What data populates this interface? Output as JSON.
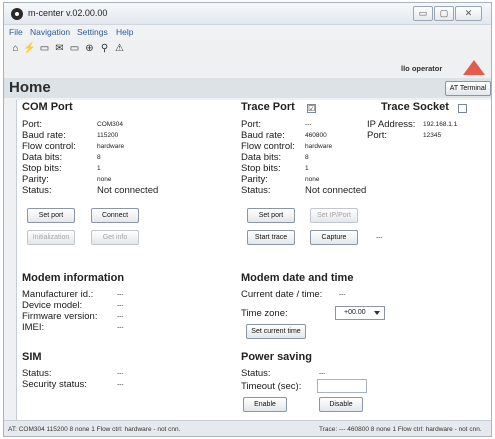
{
  "window": {
    "title": "m-center v.02.00.00",
    "min_symbol": "▭",
    "max_symbol": "▢",
    "close_symbol": "✕"
  },
  "menu": [
    "File",
    "Navigation",
    "Settings",
    "Help"
  ],
  "toolbar": {
    "icons": [
      "home-icon",
      "disconnect-icon",
      "port-icon",
      "message-icon",
      "folder-icon",
      "network-icon",
      "signal-icon",
      "warning-icon"
    ],
    "glyphs": [
      "⌂",
      "⚡",
      "▭",
      "✉",
      "▭",
      "⊕",
      "⚲",
      "⚠"
    ]
  },
  "operator": {
    "label": "llo operator",
    "color": "#e25b4b"
  },
  "home": {
    "title": "Home",
    "at_terminal_label": "AT Terminal"
  },
  "com_port": {
    "title": "COM Port",
    "labels": [
      "Port:",
      "Baud rate:",
      "Flow control:",
      "Data bits:",
      "Stop bits:",
      "Parity:",
      "Status:"
    ],
    "values": [
      "COM304",
      "115200",
      "hardware",
      "8",
      "1",
      "none",
      "Not connected"
    ],
    "set_port": "Set port",
    "connect": "Connect",
    "initialization": "Initialization",
    "get_info": "Get info"
  },
  "trace_port": {
    "title": "Trace Port",
    "checked": "☑",
    "labels": [
      "Port:",
      "Baud rate:",
      "Flow control:",
      "Data bits:",
      "Stop bits:",
      "Parity:",
      "Status:"
    ],
    "values": [
      "---",
      "460800",
      "hardware",
      "8",
      "1",
      "none",
      "Not connected"
    ],
    "set_port": "Set port",
    "set_ip_port": "Set IP/Port",
    "start_trace": "Start trace",
    "capture": "Capture",
    "capture_status": "---"
  },
  "trace_socket": {
    "title": "Trace Socket",
    "ip_label": "IP Address:",
    "ip_value": "192.168.1.1",
    "port_label": "Port:",
    "port_value": "12345"
  },
  "modem_info": {
    "title": "Modem information",
    "labels": [
      "Manufacturer id.:",
      "Device model:",
      "Firmware version:",
      "IMEI:"
    ],
    "values": [
      "---",
      "---",
      "---",
      "---"
    ]
  },
  "sim": {
    "title": "SIM",
    "labels": [
      "Status:",
      "Security status:"
    ],
    "values": [
      "---",
      "---"
    ]
  },
  "modem_datetime": {
    "title": "Modem date and time",
    "current_label": "Current date / time:",
    "current_value": "---",
    "timezone_label": "Time zone:",
    "timezone_value": "+00.00",
    "set_button": "Set current time"
  },
  "power_saving": {
    "title": "Power saving",
    "status_label": "Status:",
    "status_value": "---",
    "timeout_label": "Timeout (sec):",
    "enable": "Enable",
    "disable": "Disable"
  },
  "statusbar": {
    "left": "AT: COM304 115200 8 none 1 Flow ctrl: hardware - not cnn.",
    "right": "Trace: --- 460800 8 none 1 Flow ctrl: hardware - not cnn."
  }
}
